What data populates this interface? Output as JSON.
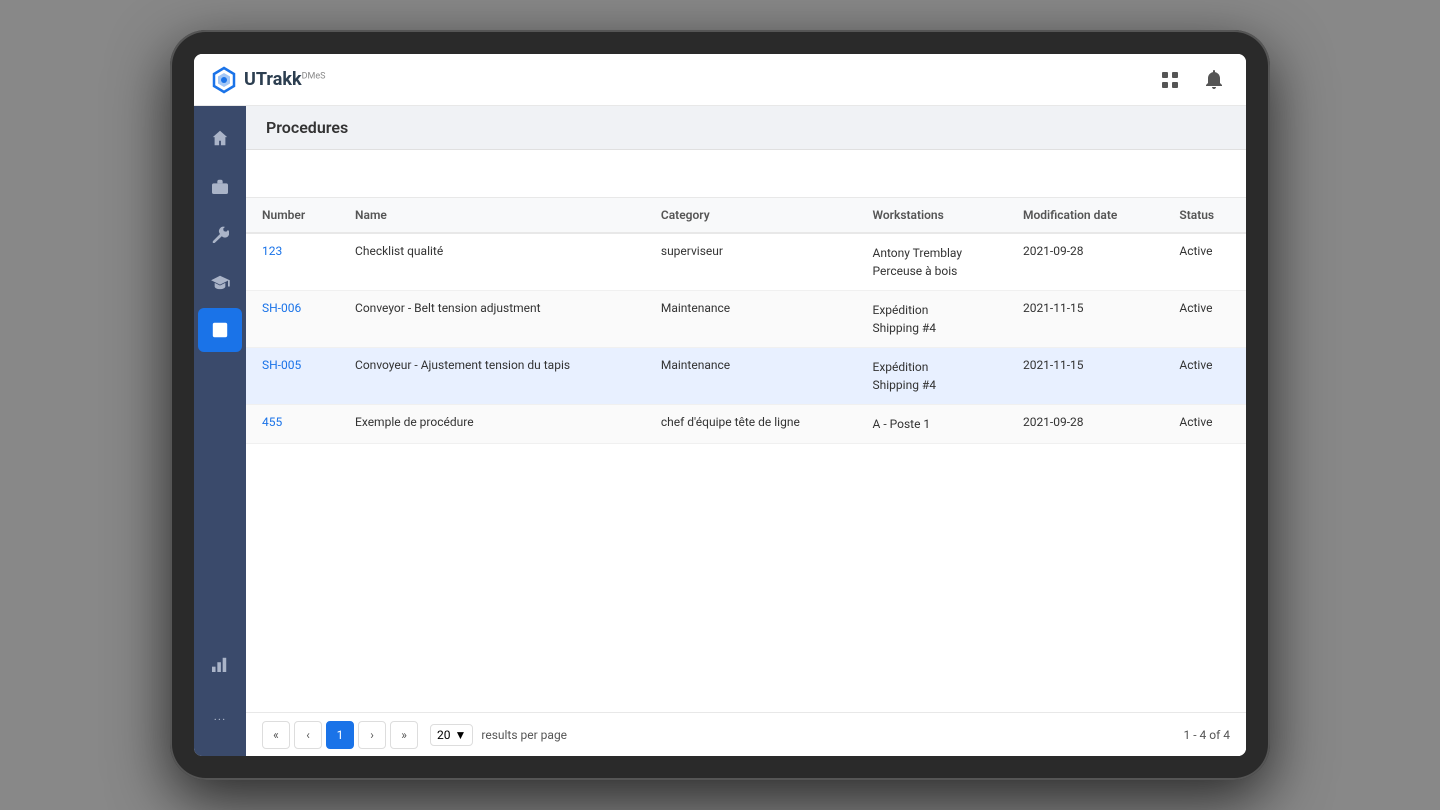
{
  "app": {
    "name": "UTrakk",
    "subtitle": "DMeS",
    "logo_emoji": "⬡"
  },
  "header": {
    "grid_icon": "⊞",
    "bell_icon": "🔔"
  },
  "sidebar": {
    "items": [
      {
        "id": "home",
        "icon": "🏠",
        "active": false
      },
      {
        "id": "briefcase",
        "icon": "💼",
        "active": false
      },
      {
        "id": "tools",
        "icon": "🔧",
        "active": false
      },
      {
        "id": "graduation",
        "icon": "🎓",
        "active": false
      },
      {
        "id": "procedures",
        "icon": "🏛",
        "active": true
      }
    ],
    "bottom": [
      {
        "id": "chart",
        "icon": "📊"
      },
      {
        "id": "more",
        "label": "..."
      }
    ]
  },
  "page": {
    "title": "Procedures"
  },
  "table": {
    "columns": [
      {
        "id": "number",
        "label": "Number"
      },
      {
        "id": "name",
        "label": "Name"
      },
      {
        "id": "category",
        "label": "Category"
      },
      {
        "id": "workstations",
        "label": "Workstations"
      },
      {
        "id": "modification_date",
        "label": "Modification date"
      },
      {
        "id": "status",
        "label": "Status"
      }
    ],
    "rows": [
      {
        "number": "123",
        "name": "Checklist qualité",
        "category": "superviseur",
        "workstations": "Antony Tremblay\nPerceuse à bois",
        "workstation_line1": "Antony Tremblay",
        "workstation_line2": "Perceuse à bois",
        "modification_date": "2021-09-28",
        "status": "Active",
        "highlighted": false
      },
      {
        "number": "SH-006",
        "name": "Conveyor - Belt tension adjustment",
        "category": "Maintenance",
        "workstations": "Expédition\nShipping #4",
        "workstation_line1": "Expédition",
        "workstation_line2": "Shipping #4",
        "modification_date": "2021-11-15",
        "status": "Active",
        "highlighted": false
      },
      {
        "number": "SH-005",
        "name": "Convoyeur - Ajustement tension du tapis",
        "category": "Maintenance",
        "workstations": "Expédition\nShipping #4",
        "workstation_line1": "Expédition",
        "workstation_line2": "Shipping #4",
        "modification_date": "2021-11-15",
        "status": "Active",
        "highlighted": true
      },
      {
        "number": "455",
        "name": "Exemple de procédure",
        "category": "chef d'équipe tête de ligne",
        "workstations": "A - Poste 1",
        "workstation_line1": "A - Poste 1",
        "workstation_line2": "",
        "modification_date": "2021-09-28",
        "status": "Active",
        "highlighted": false
      }
    ]
  },
  "pagination": {
    "first_label": "«",
    "prev_label": "‹",
    "current_page": 1,
    "next_label": "›",
    "last_label": "»",
    "per_page": "20",
    "results_label": "results per page",
    "range_text": "1 - 4 of 4"
  }
}
